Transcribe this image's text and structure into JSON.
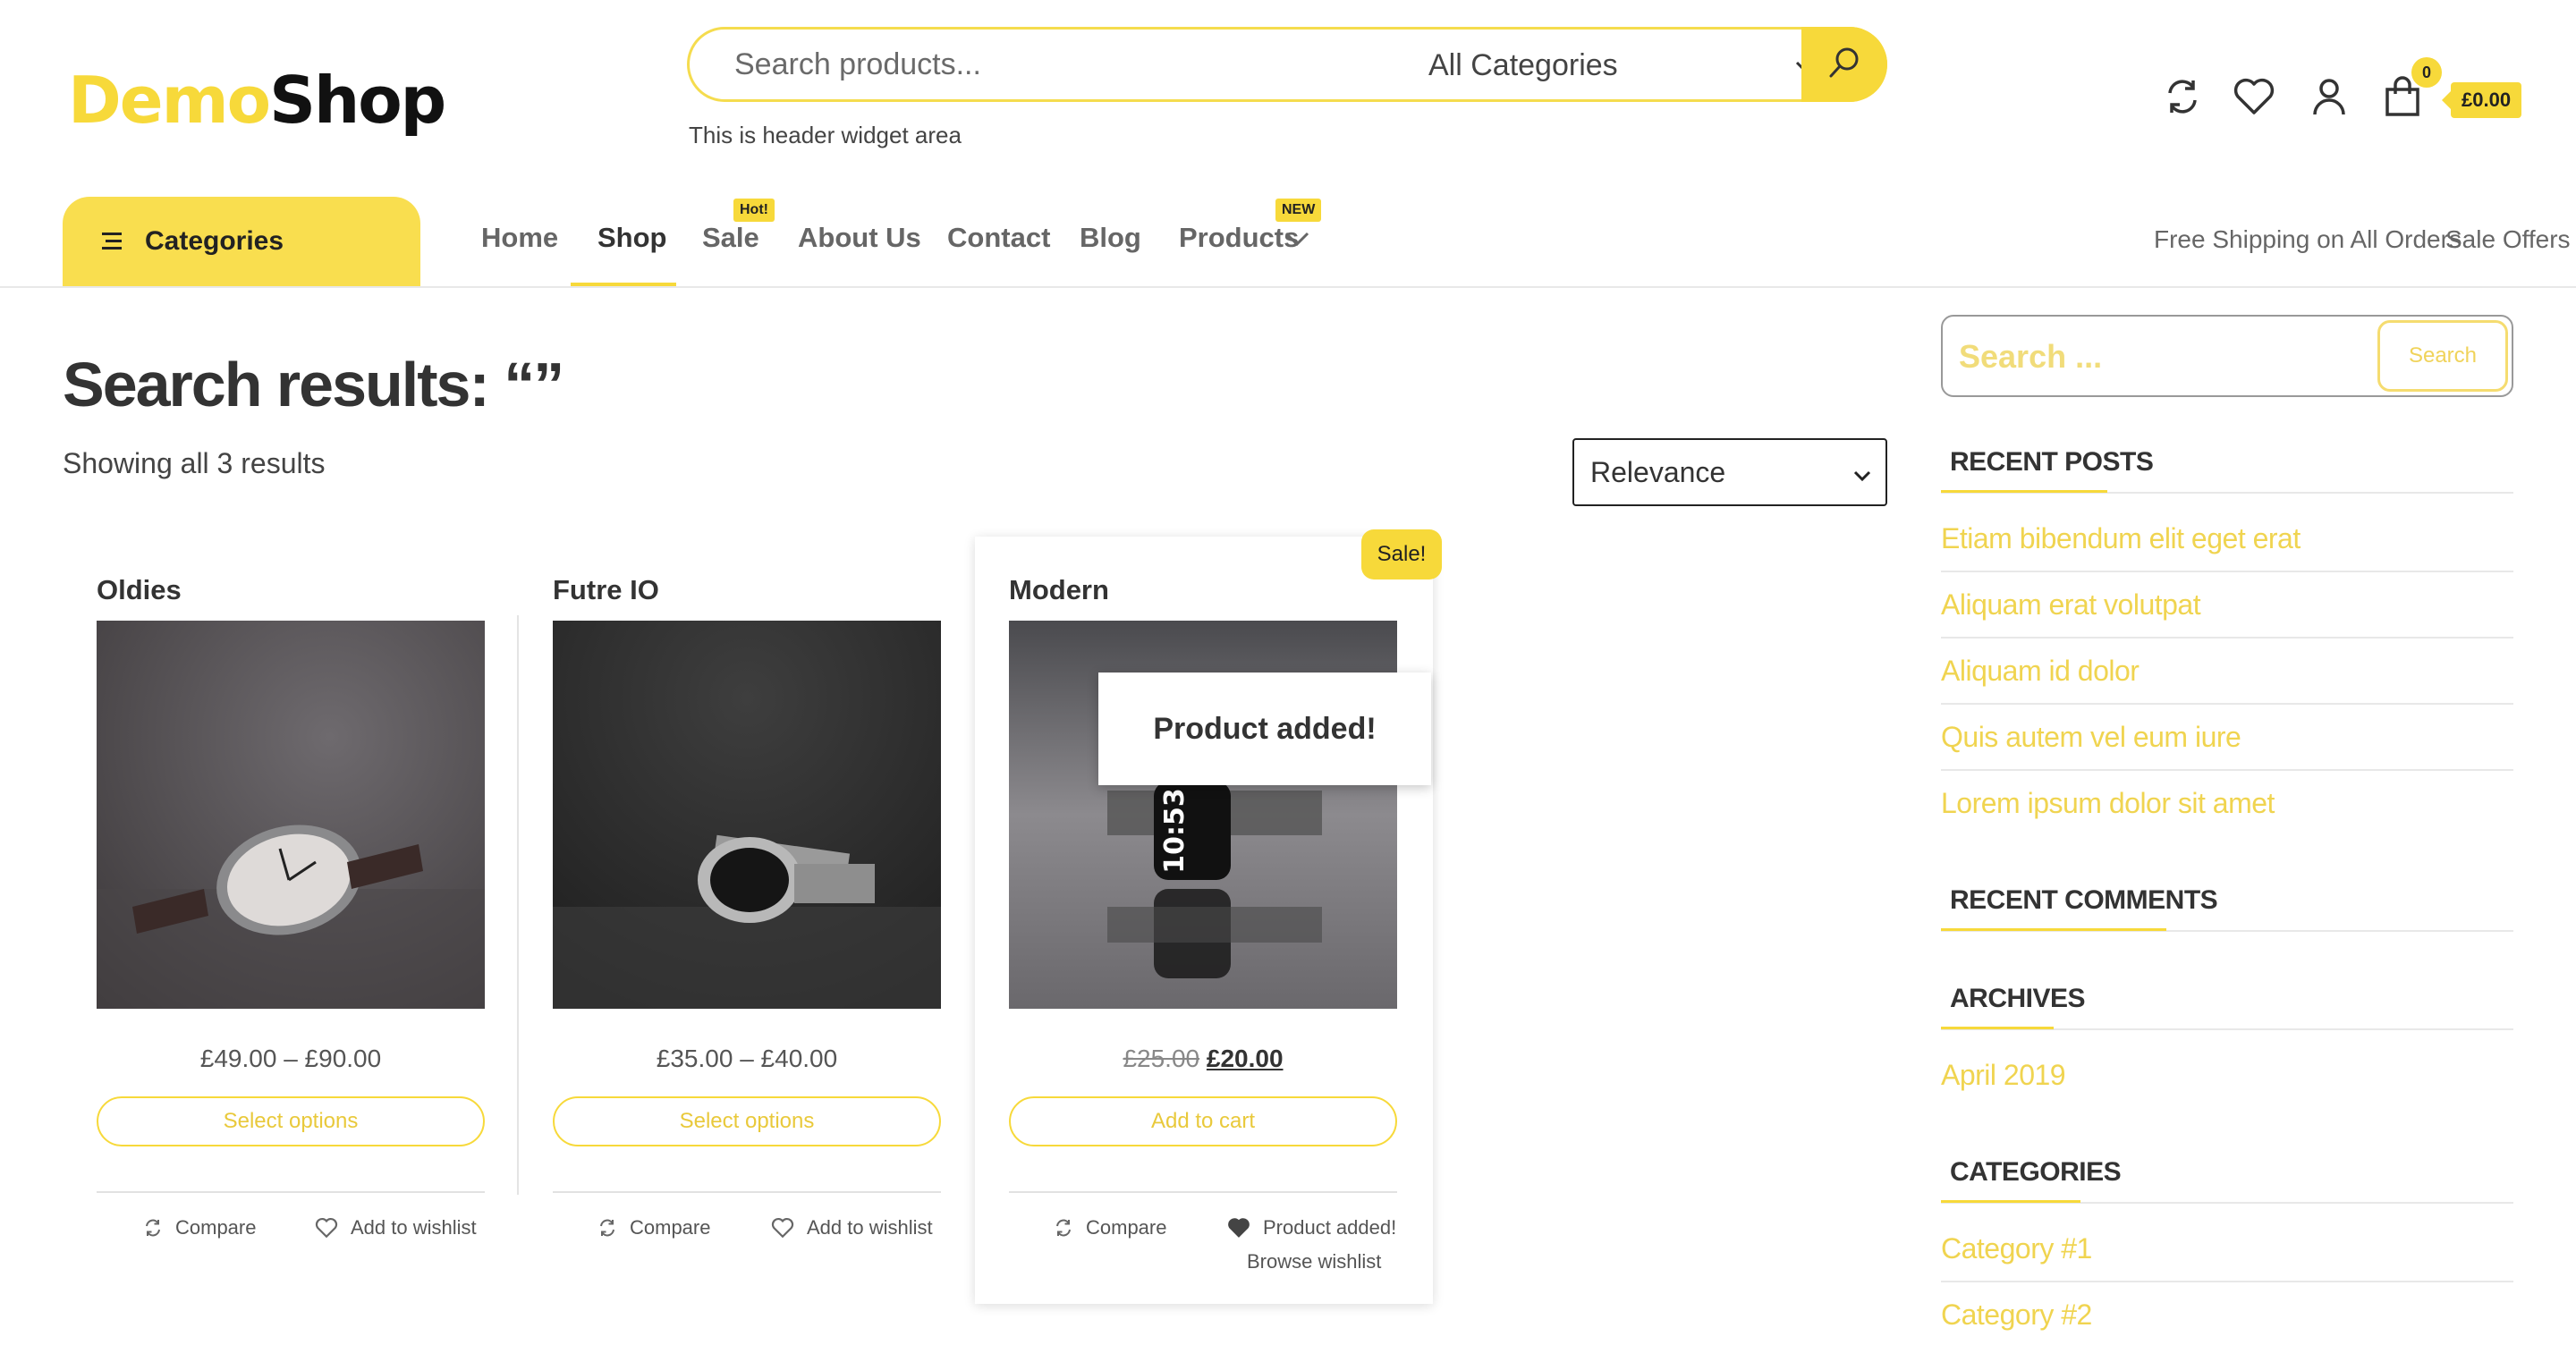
{
  "header": {
    "logo": {
      "part1": "Demo",
      "part2": "Shop"
    },
    "search": {
      "placeholder": "Search products...",
      "category": "All Categories"
    },
    "widget_text": "This is header widget area",
    "cart": {
      "count": "0",
      "total": "£0.00"
    }
  },
  "nav": {
    "categories_label": "Categories",
    "items": [
      {
        "label": "Home"
      },
      {
        "label": "Shop"
      },
      {
        "label": "Sale",
        "badge": "Hot!"
      },
      {
        "label": "About Us"
      },
      {
        "label": "Contact"
      },
      {
        "label": "Blog"
      },
      {
        "label": "Products",
        "badge": "NEW"
      }
    ],
    "right_links": [
      "Free Shipping on All Orders",
      "Sale Offers"
    ]
  },
  "main": {
    "title": "Search results: “”",
    "showing": "Showing all 3 results",
    "sort": "Relevance",
    "products": [
      {
        "name": "Oldies",
        "price": "£49.00 – £90.00",
        "button": "Select options",
        "compare": "Compare",
        "wishlist": "Add to wishlist"
      },
      {
        "name": "Futre IO",
        "price": "£35.00 – £40.00",
        "button": "Select options",
        "compare": "Compare",
        "wishlist": "Add to wishlist"
      },
      {
        "name": "Modern",
        "old_price": "£25.00",
        "price": "£20.00",
        "button": "Add to cart",
        "compare": "Compare",
        "wishlist": "Product added!",
        "browse": "Browse wishlist",
        "sale_badge": "Sale!"
      }
    ],
    "toast": "Product added!"
  },
  "sidebar": {
    "search_placeholder": "Search ...",
    "search_button": "Search",
    "recent_posts_title": "RECENT POSTS",
    "recent_posts": [
      "Etiam bibendum elit eget erat",
      "Aliquam erat volutpat",
      "Aliquam id dolor",
      "Quis autem vel eum iure",
      "Lorem ipsum dolor sit amet"
    ],
    "recent_comments_title": "RECENT COMMENTS",
    "archives_title": "ARCHIVES",
    "archives": [
      "April 2019"
    ],
    "categories_title": "CATEGORIES",
    "categories": [
      "Category #1",
      "Category #2"
    ]
  },
  "colors": {
    "accent": "#f7d93a",
    "text": "#333333",
    "link": "#f0d450"
  }
}
